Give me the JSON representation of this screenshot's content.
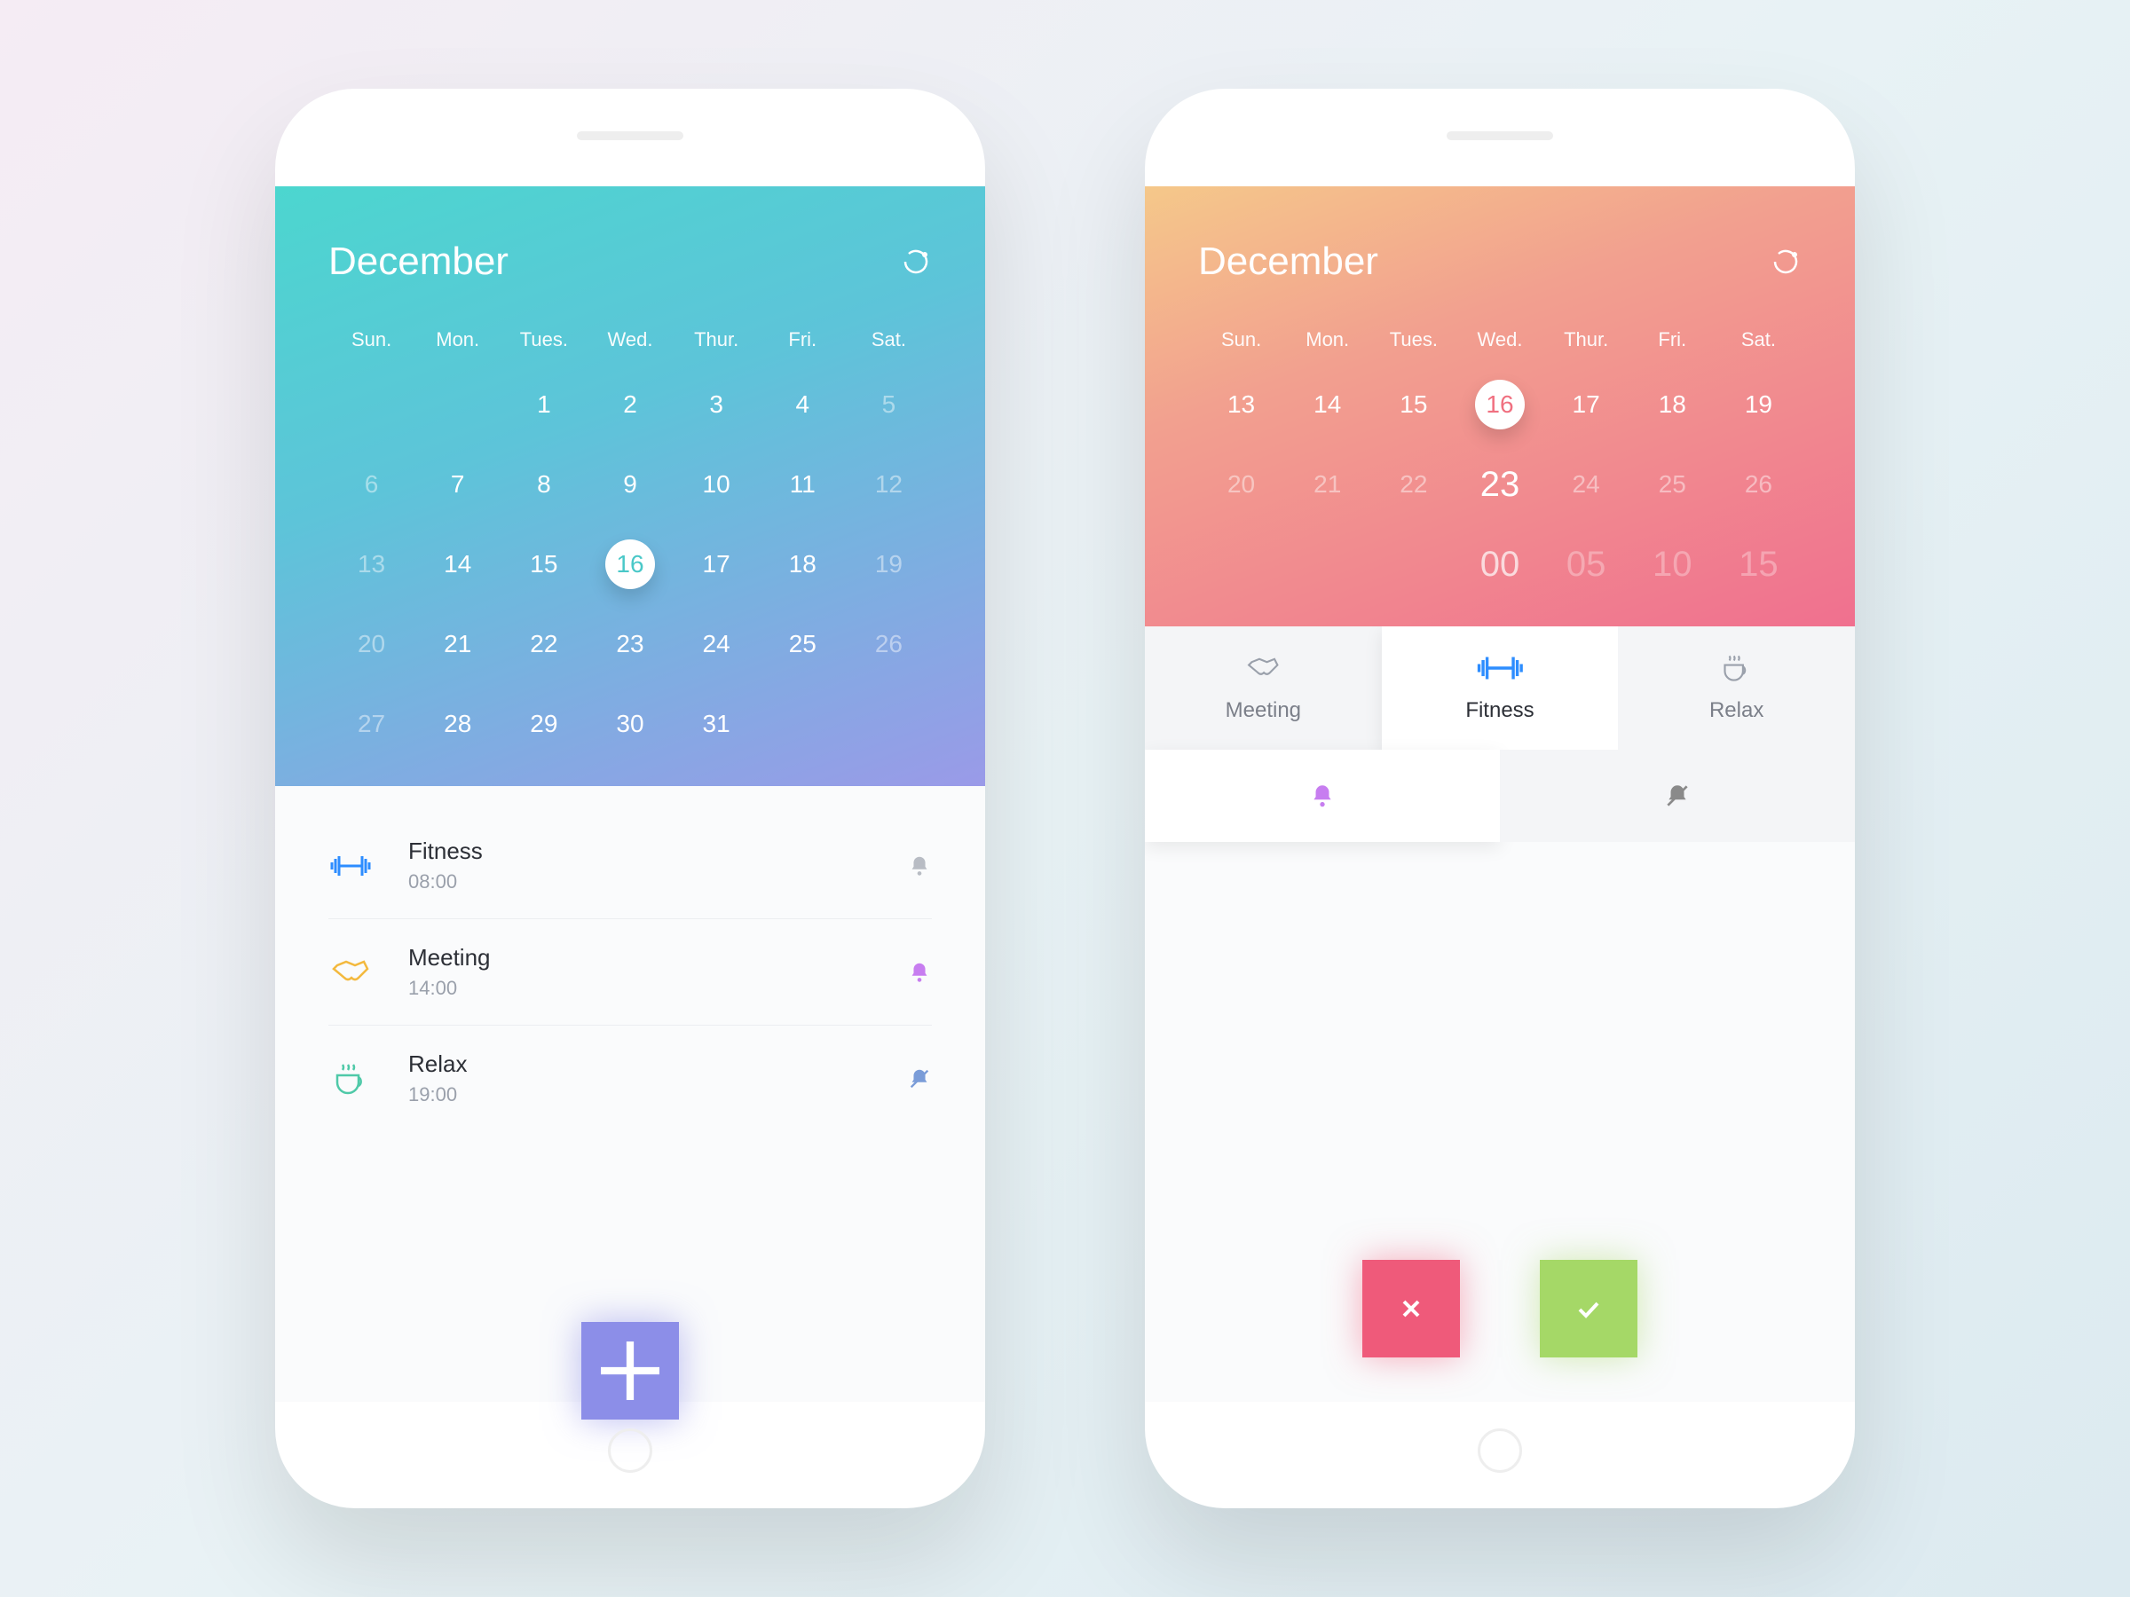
{
  "month": "December",
  "dow": [
    "Sun.",
    "Mon.",
    "Tues.",
    "Wed.",
    "Thur.",
    "Fri.",
    "Sat."
  ],
  "left": {
    "selected": 16,
    "rows": [
      [
        "",
        "",
        "1",
        "2",
        "3",
        "4",
        "5"
      ],
      [
        "6",
        "7",
        "8",
        "9",
        "10",
        "11",
        "12"
      ],
      [
        "13",
        "14",
        "15",
        "16",
        "17",
        "18",
        "19"
      ],
      [
        "20",
        "21",
        "22",
        "23",
        "24",
        "25",
        "26"
      ],
      [
        "27",
        "28",
        "29",
        "30",
        "31",
        "",
        ""
      ]
    ],
    "dim_cols_row0": [
      0,
      1
    ],
    "dim_cols_last": [
      5,
      6
    ],
    "events": [
      {
        "icon": "dumbbell",
        "color": "#2d8dff",
        "title": "Fitness",
        "time": "08:00",
        "bell": "grey"
      },
      {
        "icon": "handshake",
        "color": "#f3b93e",
        "title": "Meeting",
        "time": "14:00",
        "bell": "purple"
      },
      {
        "icon": "coffee",
        "color": "#4fc9a8",
        "title": "Relax",
        "time": "19:00",
        "bell": "muted"
      }
    ]
  },
  "right": {
    "selected": 16,
    "rows": [
      [
        "13",
        "14",
        "15",
        "16",
        "17",
        "18",
        "19"
      ],
      [
        "20",
        "21",
        "22",
        "23",
        "24",
        "25",
        "26"
      ],
      [
        "",
        "",
        "",
        "00",
        "05",
        "10",
        "15"
      ]
    ],
    "categories": [
      {
        "icon": "handshake",
        "label": "Meeting",
        "active": false,
        "color": "#9aa0ab"
      },
      {
        "icon": "dumbbell",
        "label": "Fitness",
        "active": true,
        "color": "#2d8dff"
      },
      {
        "icon": "coffee",
        "label": "Relax",
        "active": false,
        "color": "#9aa0ab"
      }
    ],
    "alerts": [
      {
        "icon": "bell",
        "color": "#c77df0",
        "active": true
      },
      {
        "icon": "bell-off",
        "color": "#8a8a8a",
        "active": false
      }
    ],
    "actions": {
      "cancel": "×",
      "confirm": "✓"
    }
  },
  "colors": {
    "fab": "#8c8ee8",
    "cancel": "#ef5a7a",
    "confirm": "#a5d867",
    "bell_grey": "#b8bcc4",
    "bell_purple": "#c77df0",
    "bell_muted": "#7a9cd8"
  }
}
